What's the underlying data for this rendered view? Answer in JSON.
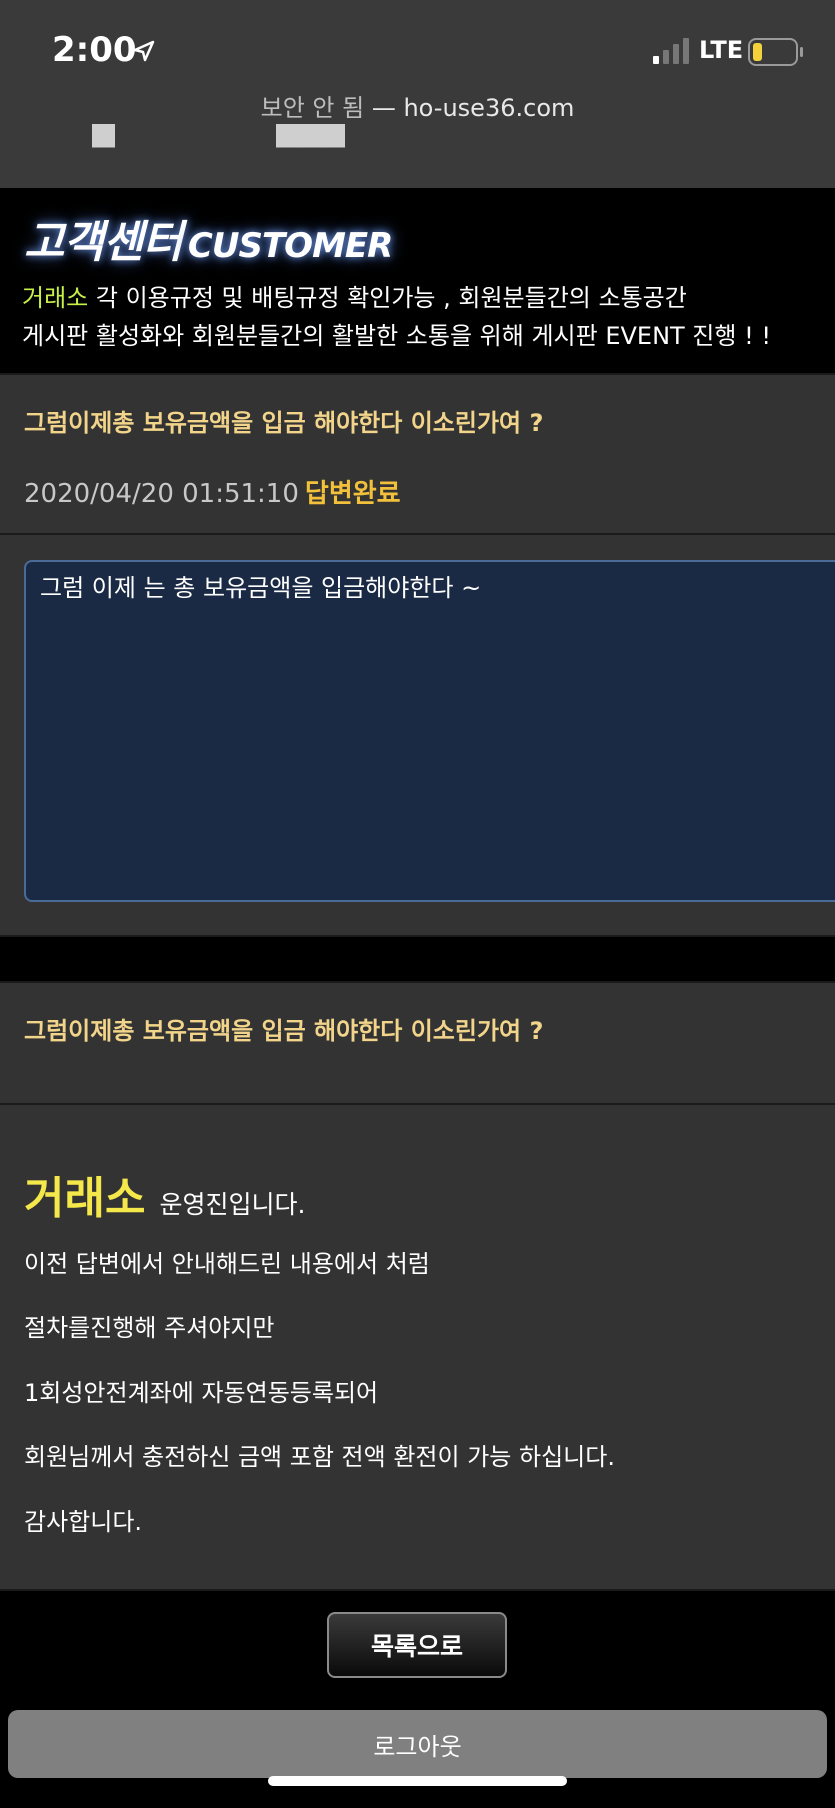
{
  "status": {
    "time": "2:00",
    "network": "LTE"
  },
  "browser": {
    "insecure_label": "보안 안 됨",
    "separator": " — ",
    "domain": "ho-use36.com"
  },
  "banner": {
    "title_kr": "고객센터",
    "title_en": "CUSTOMER",
    "line1_highlight": "거래소",
    "line1_rest": " 각 이용규정 및 배팅규정 확인가능 , 회원분들간의 소통공간",
    "line2": "게시판 활성화와 회원분들간의 활발한 소통을 위해 게시판 EVENT 진행 ! !"
  },
  "question": {
    "title": "그럼이제총 보유금액을 입금 해야한다 이소린가여 ?",
    "datetime": "2020/04/20 01:51:10",
    "status": "답변완료",
    "body": "그럼 이제 는 총 보유금액을 입금해야한다 ~"
  },
  "answer": {
    "title": "그럼이제총 보유금액을 입금 해야한다 이소린가여 ?",
    "brand": "거래소",
    "greeting": "운영진입니다.",
    "lines": [
      "이전 답변에서 안내해드린 내용에서 처럼",
      "절차를진행해 주셔야지만",
      "1회성안전계좌에 자동연동등록되어",
      "회원님께서 충전하신 금액 포함 전액 환전이 가능 하십니다.",
      "감사합니다."
    ]
  },
  "buttons": {
    "list": "목록으로",
    "logout": "로그아웃"
  },
  "colors": {
    "accent_title": "#f2d58a",
    "status_done": "#f2c03a",
    "brand_yellow": "#f5e84a",
    "highlight_green": "#c8f04a"
  }
}
